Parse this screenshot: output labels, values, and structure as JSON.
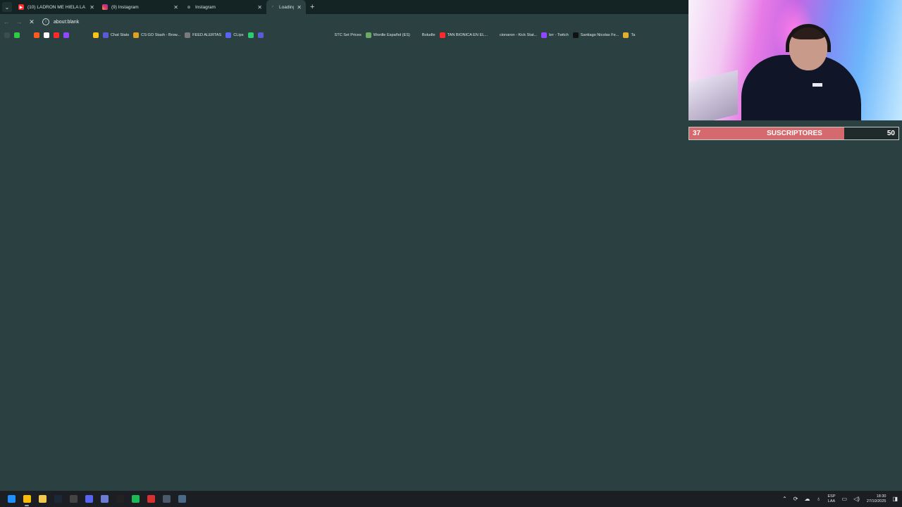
{
  "browser": {
    "tabs": [
      {
        "title": "(10) LADRÓN ME HIELA LA SAN",
        "icon": "youtube-icon",
        "color": "#ff2a2a",
        "active": false
      },
      {
        "title": "(9) Instagram",
        "icon": "instagram-icon",
        "color": "#e1306c",
        "active": false
      },
      {
        "title": "Instagram",
        "icon": "link-icon",
        "color": "#9fb3b3",
        "active": false
      },
      {
        "title": "Loading",
        "icon": "loading-icon",
        "color": "#9fb3b3",
        "active": true
      }
    ],
    "new_tab": "+",
    "address": "about:blank"
  },
  "bookmarks": [
    {
      "label": "",
      "icon": "apps-grid-icon",
      "color": "#3a4e4e"
    },
    {
      "label": "",
      "icon": "kick-icon",
      "color": "#2ecc40"
    },
    {
      "label": "",
      "icon": "diamond-icon",
      "color": "#2b4141"
    },
    {
      "label": "",
      "icon": "faceit-icon",
      "color": "#ff5a1f"
    },
    {
      "label": "",
      "icon": "a-icon",
      "color": "#ffffff"
    },
    {
      "label": "",
      "icon": "youtube-icon",
      "color": "#ff2a2a"
    },
    {
      "label": "",
      "icon": "twitch-icon",
      "color": "#9146ff"
    },
    {
      "label": "",
      "icon": "link-icon",
      "color": "#2b4141"
    },
    {
      "label": "",
      "icon": "streamlabs-icon",
      "color": "#2b4141"
    },
    {
      "label": "",
      "icon": "bookmark-y-icon",
      "color": "#f5c518"
    },
    {
      "label": "Chat Stats",
      "icon": "anchor-icon",
      "color": "#5b5bd6"
    },
    {
      "label": "CS:GO Stash - Brow...",
      "icon": "csgo-icon",
      "color": "#e0a020"
    },
    {
      "label": "FEED ALERTAS",
      "icon": "feed-icon",
      "color": "#7a7a7a"
    },
    {
      "label": "CLips",
      "icon": "clips-icon",
      "color": "#5865f2"
    },
    {
      "label": "",
      "icon": "green-square-icon",
      "color": "#2ecc71"
    },
    {
      "label": "",
      "icon": "anchor-icon",
      "color": "#5b5bd6"
    },
    {
      "label": "",
      "icon": "cloud-icon",
      "color": "#2b4141"
    },
    {
      "label": "",
      "icon": "dot-icon",
      "color": "#2b4141"
    },
    {
      "label": "",
      "icon": "check-icon",
      "color": "#2b4141"
    },
    {
      "label": "",
      "icon": "circle-icon",
      "color": "#2b4141"
    },
    {
      "label": "",
      "icon": "binance-icon",
      "color": "#2b4141"
    },
    {
      "label": "",
      "icon": "arrow-icon",
      "color": "#2b4141"
    },
    {
      "label": "STC Set Prices",
      "icon": "stc-icon",
      "color": "#2b4141"
    },
    {
      "label": "Wordle Español (ES)",
      "icon": "wordle-icon",
      "color": "#6aaa64"
    },
    {
      "label": "Boludle",
      "icon": "globe-icon",
      "color": "#2b4141"
    },
    {
      "label": "TAN BIONICA EN EL...",
      "icon": "youtube-icon",
      "color": "#ff2a2a"
    },
    {
      "label": "cionaron - Kick Stat...",
      "icon": "globe-icon",
      "color": "#2b4141"
    },
    {
      "label": "brr - Twitch",
      "icon": "twitch-icon",
      "color": "#9146ff"
    },
    {
      "label": "Santiago Nicolas Fe...",
      "icon": "tiktok-icon",
      "color": "#111111"
    },
    {
      "label": "Ta",
      "icon": "folder-icon",
      "color": "#e0b030"
    }
  ],
  "subscriber_goal": {
    "current": "37",
    "label": "SUSCRIPTORES",
    "target": "50",
    "progress": 0.74,
    "fill_color": "#d46a6e"
  },
  "taskbar": {
    "apps": [
      {
        "name": "windows-start-icon",
        "color": "#1e90ff"
      },
      {
        "name": "chrome-icon",
        "color": "#fbbc05"
      },
      {
        "name": "file-explorer-icon",
        "color": "#f2c94c"
      },
      {
        "name": "steam-icon",
        "color": "#1b2838"
      },
      {
        "name": "obs-icon",
        "color": "#444444"
      },
      {
        "name": "discord-icon",
        "color": "#5865f2"
      },
      {
        "name": "chat-app-icon",
        "color": "#6c7bd6"
      },
      {
        "name": "capcut-icon",
        "color": "#222222"
      },
      {
        "name": "spotify-icon",
        "color": "#1db954"
      },
      {
        "name": "media-app-icon",
        "color": "#d63031"
      },
      {
        "name": "settings-app-icon",
        "color": "#4a5a6a"
      },
      {
        "name": "controller-app-icon",
        "color": "#4a6a8a"
      }
    ],
    "lang_top": "ESP",
    "lang_bottom": "LAA",
    "time": "18:30",
    "date": "27/10/2025"
  }
}
